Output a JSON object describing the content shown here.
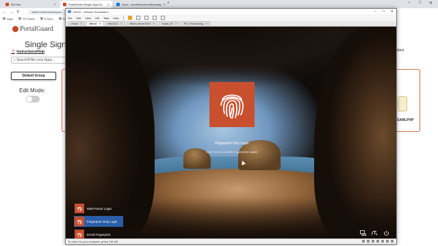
{
  "browser": {
    "tabs": [
      {
        "label": "BIO key",
        "color": "#c8502f",
        "active": false
      },
      {
        "label": "PortalGuard Single Sign-On",
        "color": "#c8502f",
        "active": true
      },
      {
        "label": "Inbox - serveflow.demo@portalg",
        "color": "#1a73e8",
        "active": false
      }
    ],
    "new_tab": "+",
    "url": "stilant.bioidentarolloguar...",
    "bookmarks": [
      "Apps",
      "PG Home",
      "E-Sync",
      "Self"
    ]
  },
  "portalguard": {
    "logo_text": "PortalGuard",
    "title": "Single Sign-O",
    "help_link": "Instructions/Help",
    "search_placeholder": "Search/Filter your Apps...",
    "group_label": "Default Group",
    "edit_mode_label": "Edit Mode:",
    "right_user": "pbled",
    "app_label": "SAMLPHP"
  },
  "vmware": {
    "title": "Win10 - VMware Workstation",
    "menu": [
      "File",
      "Edit",
      "View",
      "VM",
      "Tabs",
      "Help"
    ],
    "tabs": [
      {
        "label": "Home",
        "active": false
      },
      {
        "label": "Win10",
        "active": true
      },
      {
        "label": "Win2012",
        "active": false
      },
      {
        "label": "Winter-server2019",
        "active": false
      },
      {
        "label": "Install_t4f",
        "active": false
      },
      {
        "label": "PG_Provisioning",
        "active": false
      }
    ],
    "status": "To return to your computer, press Ctrl+Alt."
  },
  "login": {
    "tile_label": "Fingerprint Only Login",
    "hint": "Click here to initiate fingerprint reader",
    "credential_options": [
      {
        "label": "Multi-Factor Login",
        "selected": false
      },
      {
        "label": "Fingerprint Only Login",
        "selected": true
      },
      {
        "label": "Enroll Fingerprint",
        "selected": false
      }
    ],
    "system_icons": [
      "network-icon",
      "accessibility-icon",
      "power-icon"
    ]
  },
  "colors": {
    "accent": "#c8502f",
    "selection": "#2b5ea8"
  }
}
